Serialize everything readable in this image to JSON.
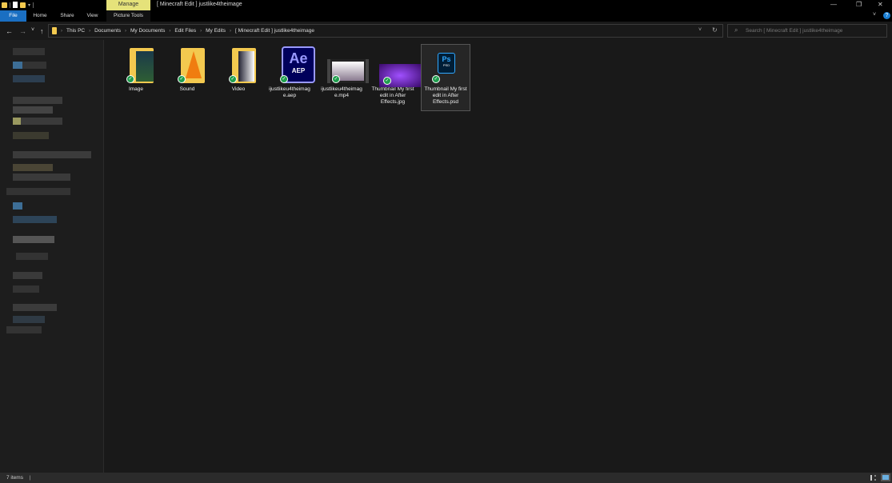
{
  "window": {
    "title": "[ Minecraft Edit ] justlike4theimage",
    "context_tab": "Manage",
    "controls": [
      "—",
      "❐",
      "✕"
    ]
  },
  "ribbon": {
    "tabs": [
      "File",
      "Home",
      "Share",
      "View",
      "Picture Tools"
    ],
    "help": "?"
  },
  "nav": {
    "back": "←",
    "forward": "→",
    "recent": "˅",
    "up": "↑",
    "refresh": "↻",
    "dropdown": "˅"
  },
  "breadcrumb": [
    "This PC",
    "Documents",
    "My Documents",
    "Edit Files",
    "My Edits",
    "[ Minecraft Edit ] justlike4theimage"
  ],
  "search": {
    "placeholder": "Search [ Minecraft Edit ] justlike4theimage"
  },
  "items": [
    {
      "name": "Image",
      "type": "folder"
    },
    {
      "name": "Sound",
      "type": "folder"
    },
    {
      "name": "Video",
      "type": "folder"
    },
    {
      "name": "ijustlikeu4theimage.aep",
      "type": "aep",
      "icon_text": "Ae",
      "sub": "AEP"
    },
    {
      "name": "ijustlikeu4theimage.mp4",
      "type": "video"
    },
    {
      "name": "Thumbnail My first edit in After Effects.jpg",
      "type": "image"
    },
    {
      "name": "Thumbnail My first edit in After Effects.psd",
      "type": "psd",
      "icon_text": "Ps",
      "sub": "PSD"
    }
  ],
  "status": {
    "count": "7 items"
  }
}
